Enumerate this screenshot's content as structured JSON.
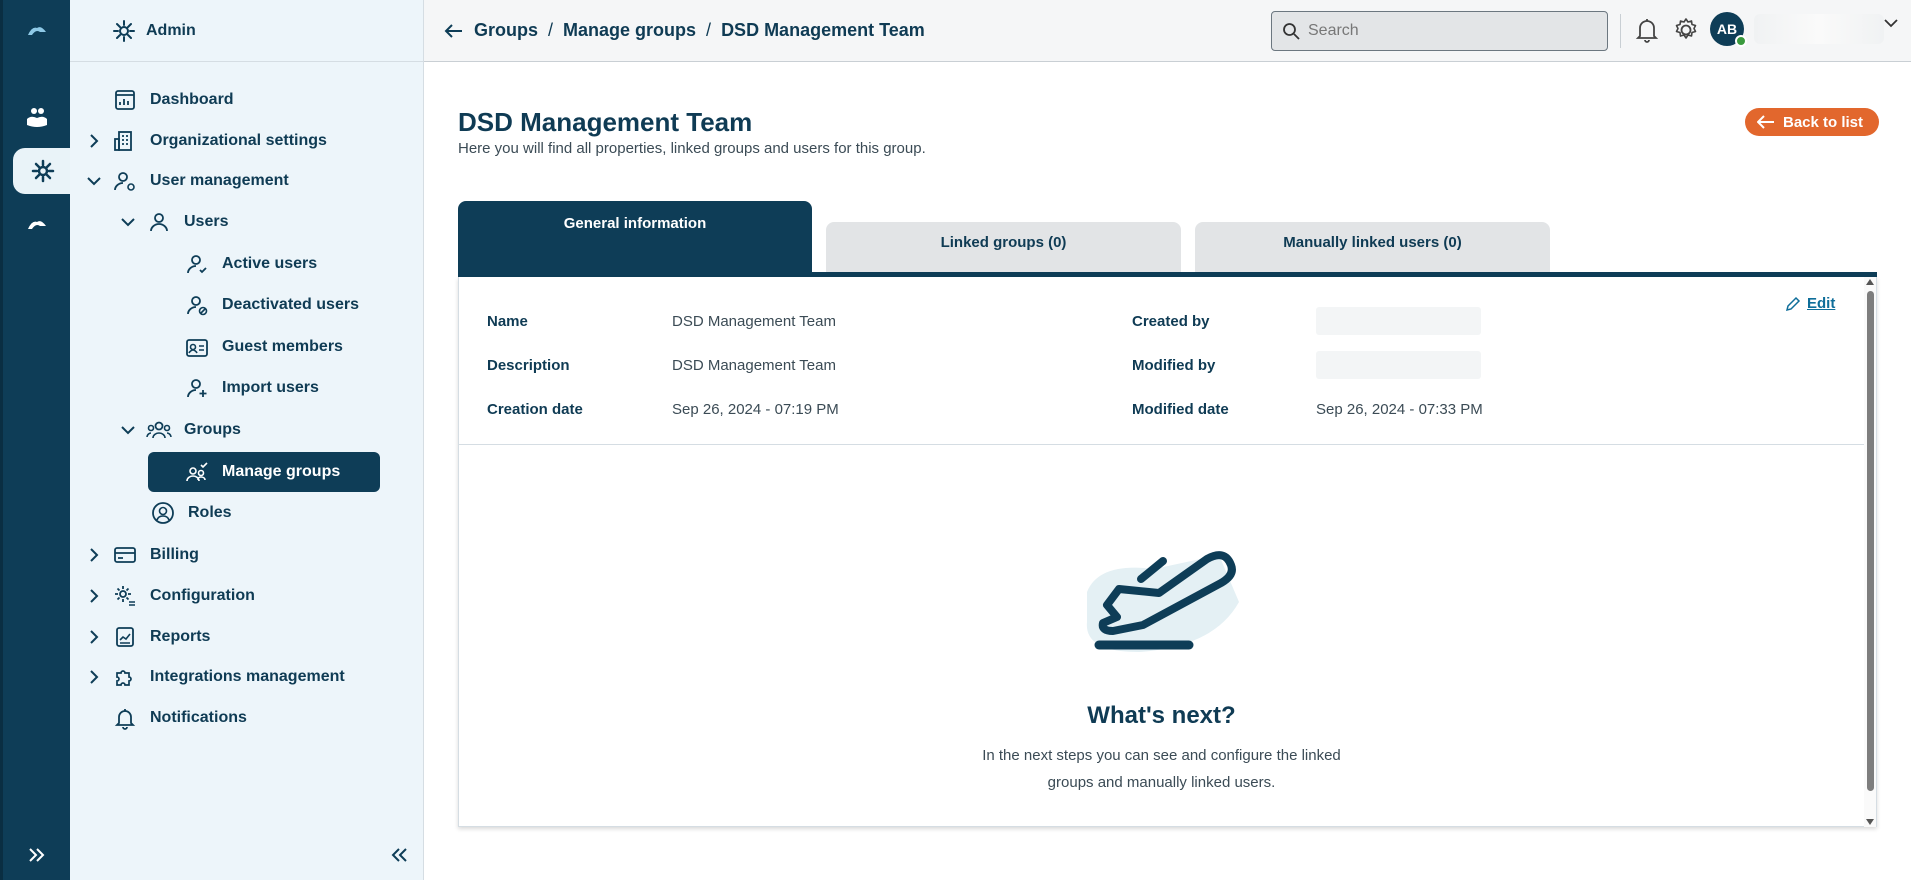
{
  "sidebar": {
    "header": "Admin",
    "items": [
      {
        "label": "Dashboard"
      },
      {
        "label": "Organizational settings"
      },
      {
        "label": "User management"
      },
      {
        "label": "Users"
      },
      {
        "label": "Active users"
      },
      {
        "label": "Deactivated users"
      },
      {
        "label": "Guest members"
      },
      {
        "label": "Import users"
      },
      {
        "label": "Groups"
      },
      {
        "label": "Manage groups"
      },
      {
        "label": "Roles"
      },
      {
        "label": "Billing"
      },
      {
        "label": "Configuration"
      },
      {
        "label": "Reports"
      },
      {
        "label": "Integrations management"
      },
      {
        "label": "Notifications"
      }
    ]
  },
  "header": {
    "breadcrumb": [
      "Groups",
      "Manage groups",
      "DSD Management Team"
    ],
    "separator": "/",
    "search_placeholder": "Search",
    "avatar_initials": "AB"
  },
  "page": {
    "title": "DSD Management Team",
    "subtitle": "Here you will find all properties, linked groups and users for this group.",
    "back_label": "Back to list"
  },
  "tabs": [
    {
      "label": "General information"
    },
    {
      "label": "Linked groups (0)"
    },
    {
      "label": "Manually linked users (0)"
    }
  ],
  "info": {
    "edit_label": "Edit",
    "name_label": "Name",
    "name_value": "DSD Management Team",
    "description_label": "Description",
    "description_value": "DSD Management Team",
    "creation_date_label": "Creation date",
    "creation_date_value": "Sep 26, 2024 - 07:19 PM",
    "created_by_label": "Created by",
    "modified_by_label": "Modified by",
    "modified_date_label": "Modified date",
    "modified_date_value": "Sep 26, 2024 - 07:33 PM"
  },
  "empty_state": {
    "title": "What's next?",
    "text": "In the next steps you can see and configure the linked groups and manually linked users."
  },
  "colors": {
    "primary": "#0e3d57",
    "accent": "#e2672d",
    "sidebar_bg": "#edf5fa"
  }
}
